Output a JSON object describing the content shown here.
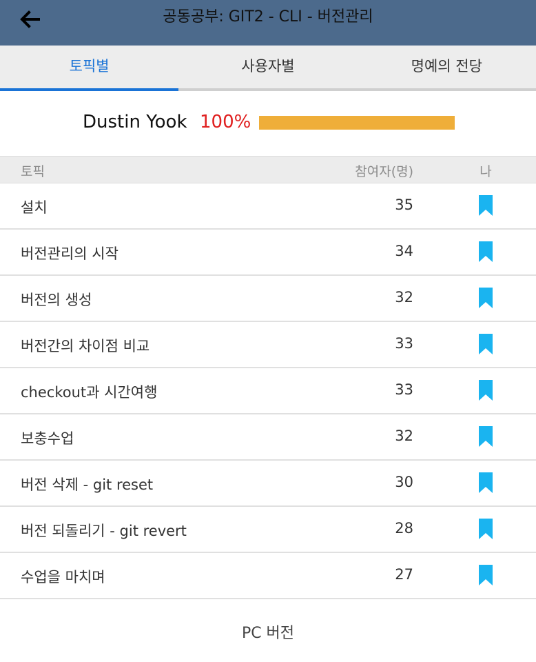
{
  "header": {
    "title": "공동공부: GIT2 - CLI - 버전관리",
    "back_icon": "arrow-left-icon"
  },
  "tabs": [
    {
      "label": "토픽별",
      "active": true
    },
    {
      "label": "사용자별",
      "active": false
    },
    {
      "label": "명예의 전당",
      "active": false
    }
  ],
  "user": {
    "name": "Dustin Yook",
    "percent_label": "100%",
    "progress": 1.0
  },
  "table": {
    "headers": {
      "topic": "토픽",
      "count": "참여자(명)",
      "me": "나"
    },
    "rows": [
      {
        "topic": "설치",
        "count": "35",
        "bookmark": "bookmark-icon"
      },
      {
        "topic": "버전관리의 시작",
        "count": "34",
        "bookmark": "bookmark-icon"
      },
      {
        "topic": "버전의 생성",
        "count": "32",
        "bookmark": "bookmark-icon"
      },
      {
        "topic": "버전간의 차이점 비교",
        "count": "33",
        "bookmark": "bookmark-icon"
      },
      {
        "topic": "checkout과 시간여행",
        "count": "33",
        "bookmark": "bookmark-icon"
      },
      {
        "topic": "보충수업",
        "count": "32",
        "bookmark": "bookmark-icon"
      },
      {
        "topic": "버전 삭제 - git reset",
        "count": "30",
        "bookmark": "bookmark-icon"
      },
      {
        "topic": "버전 되돌리기 - git revert",
        "count": "28",
        "bookmark": "bookmark-icon"
      },
      {
        "topic": "수업을 마치며",
        "count": "27",
        "bookmark": "bookmark-icon"
      }
    ]
  },
  "footer": {
    "pc_version_label": "PC 버전"
  },
  "colors": {
    "header_bg": "#4c6a8c",
    "tab_active": "#1a73d6",
    "percent": "#e02020",
    "progress": "#efae39",
    "bookmark": "#1ab4f0"
  }
}
